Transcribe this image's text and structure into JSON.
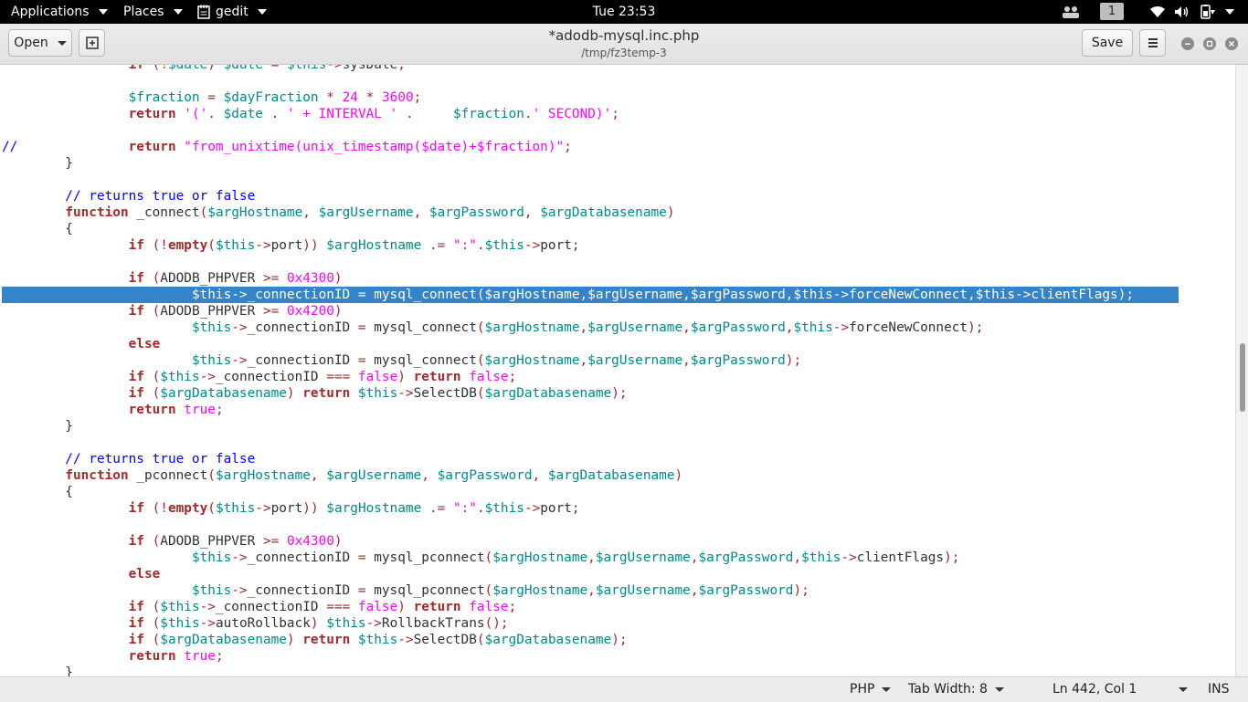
{
  "topbar": {
    "applications": "Applications",
    "places": "Places",
    "app_name": "gedit",
    "clock": "Tue 23:53",
    "workspace": "1"
  },
  "header": {
    "open_label": "Open",
    "title": "*adodb-mysql.inc.php",
    "subtitle": "/tmp/fz3temp-3",
    "save_label": "Save"
  },
  "status": {
    "language": "PHP",
    "tab_width": "Tab Width: 8",
    "position": "Ln 442, Col 1",
    "mode": "INS"
  },
  "code_lines": [
    "\t\tif (!$date) $date = $this->sysDate;",
    "",
    "\t\t$fraction = $dayFraction * 24 * 3600;",
    "\t\treturn '('. $date . ' + INTERVAL ' .\t $fraction.' SECOND)';",
    "",
    "//\t\treturn \"from_unixtime(unix_timestamp($date)+$fraction)\";",
    "\t}",
    "",
    "\t// returns true or false",
    "\tfunction _connect($argHostname, $argUsername, $argPassword, $argDatabasename)",
    "\t{",
    "\t\tif (!empty($this->port)) $argHostname .= \":\".$this->port;",
    "",
    "\t\tif (ADODB_PHPVER >= 0x4300)",
    "\t\t\t$this->_connectionID = mysql_connect($argHostname,$argUsername,$argPassword,$this->forceNewConnect,$this->clientFlags);",
    "\t\tif (ADODB_PHPVER >= 0x4200)",
    "\t\t\t$this->_connectionID = mysql_connect($argHostname,$argUsername,$argPassword,$this->forceNewConnect);",
    "\t\telse",
    "\t\t\t$this->_connectionID = mysql_connect($argHostname,$argUsername,$argPassword);",
    "\t\tif ($this->_connectionID === false) return false;",
    "\t\tif ($argDatabasename) return $this->SelectDB($argDatabasename);",
    "\t\treturn true;",
    "\t}",
    "",
    "\t// returns true or false",
    "\tfunction _pconnect($argHostname, $argUsername, $argPassword, $argDatabasename)",
    "\t{",
    "\t\tif (!empty($this->port)) $argHostname .= \":\".$this->port;",
    "",
    "\t\tif (ADODB_PHPVER >= 0x4300)",
    "\t\t\t$this->_connectionID = mysql_pconnect($argHostname,$argUsername,$argPassword,$this->clientFlags);",
    "\t\telse",
    "\t\t\t$this->_connectionID = mysql_pconnect($argHostname,$argUsername,$argPassword);",
    "\t\tif ($this->_connectionID === false) return false;",
    "\t\tif ($this->autoRollback) $this->RollbackTrans();",
    "\t\tif ($argDatabasename) return $this->SelectDB($argDatabasename);",
    "\t\treturn true;",
    "\t}"
  ],
  "selected_line": 14
}
